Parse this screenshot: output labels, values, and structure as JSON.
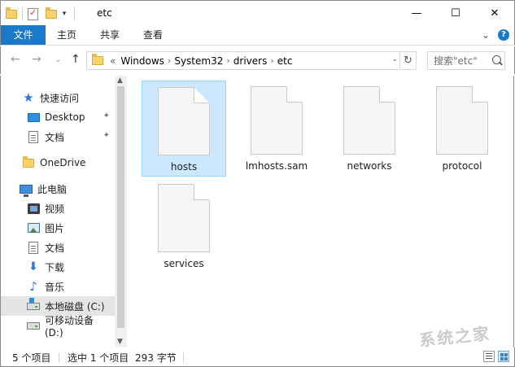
{
  "window": {
    "title": "etc",
    "minimize_glyph": "—",
    "maximize_glyph": "☐",
    "close_glyph": "✕"
  },
  "quick_access_toolbar": {
    "dropdown_glyph": "▾"
  },
  "ribbon": {
    "tabs": [
      {
        "label": "文件",
        "active": true
      },
      {
        "label": "主页"
      },
      {
        "label": "共享"
      },
      {
        "label": "查看"
      }
    ],
    "collapse_glyph": "⌄",
    "help_glyph": "?"
  },
  "navigation": {
    "back_glyph": "←",
    "forward_glyph": "→",
    "recent_glyph": "⌄",
    "up_glyph": "↑",
    "overflow_glyph": "«",
    "breadcrumb": [
      "Windows",
      "System32",
      "drivers",
      "etc"
    ],
    "separator_glyph": "›",
    "dropdown_glyph": "⌄",
    "refresh_glyph": "↻"
  },
  "search": {
    "placeholder": "搜索\"etc\""
  },
  "sidebar": {
    "scroll_up_glyph": "▲",
    "scroll_down_glyph": "▼",
    "items": [
      {
        "label": "快速访问",
        "icon": "star-icon"
      },
      {
        "label": "Desktop",
        "icon": "desktop-icon",
        "pinned": true
      },
      {
        "label": "文档",
        "icon": "document-icon",
        "pinned": true
      },
      {
        "label": "OneDrive",
        "icon": "folder-icon"
      },
      {
        "label": "此电脑",
        "icon": "computer-icon"
      },
      {
        "label": "视频",
        "icon": "video-icon"
      },
      {
        "label": "图片",
        "icon": "picture-icon"
      },
      {
        "label": "文档",
        "icon": "document-icon"
      },
      {
        "label": "下载",
        "icon": "download-icon"
      },
      {
        "label": "音乐",
        "icon": "music-icon"
      },
      {
        "label": "本地磁盘 (C:)",
        "icon": "drive-icon",
        "selected": true
      },
      {
        "label": "可移动设备 (D:)",
        "icon": "removable-drive-icon"
      }
    ],
    "pin_glyph": "📌"
  },
  "files": [
    {
      "name": "hosts",
      "selected": true
    },
    {
      "name": "lmhosts.sam"
    },
    {
      "name": "networks"
    },
    {
      "name": "protocol"
    },
    {
      "name": "services"
    }
  ],
  "status": {
    "item_count": "5 个项目",
    "selection": "选中 1 个项目",
    "size": "293 字节"
  },
  "watermark": "系统之家"
}
